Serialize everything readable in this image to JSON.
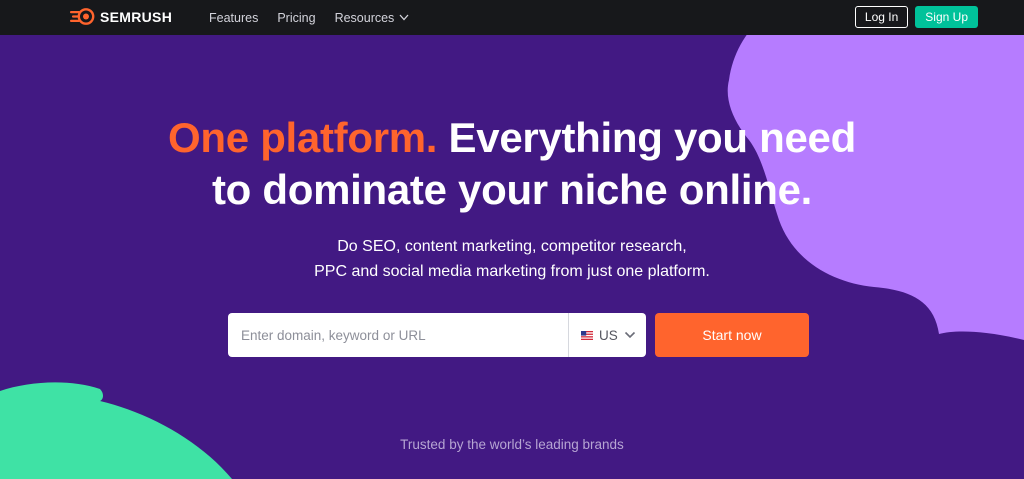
{
  "nav": {
    "logo_text": "SEMRUSH",
    "links": [
      {
        "label": "Features"
      },
      {
        "label": "Pricing"
      },
      {
        "label": "Resources"
      }
    ],
    "login_label": "Log In",
    "signup_label": "Sign Up"
  },
  "hero": {
    "title_accent": "One platform.",
    "title_line1": " Everything you need",
    "title_line2": "to dominate your niche online.",
    "subtitle_line1": "Do SEO, content marketing, competitor research,",
    "subtitle_line2": "PPC and social media marketing from just one platform."
  },
  "search": {
    "placeholder": "Enter domain, keyword or URL",
    "value": "",
    "country": "US",
    "button_label": "Start now"
  },
  "trusted_text": "Trusted by the world’s leading brands",
  "colors": {
    "background": "#421983",
    "navbar": "#17181b",
    "accent_orange": "#ff642d",
    "signup_green": "#00c29a",
    "blob_purple": "#b67cff",
    "blob_green": "#3fe2a5"
  },
  "icons": {
    "logo": "semrush-fire-icon",
    "resources_dropdown": "chevron-down-icon",
    "country_flag": "us-flag-icon",
    "country_dropdown": "chevron-down-icon"
  }
}
